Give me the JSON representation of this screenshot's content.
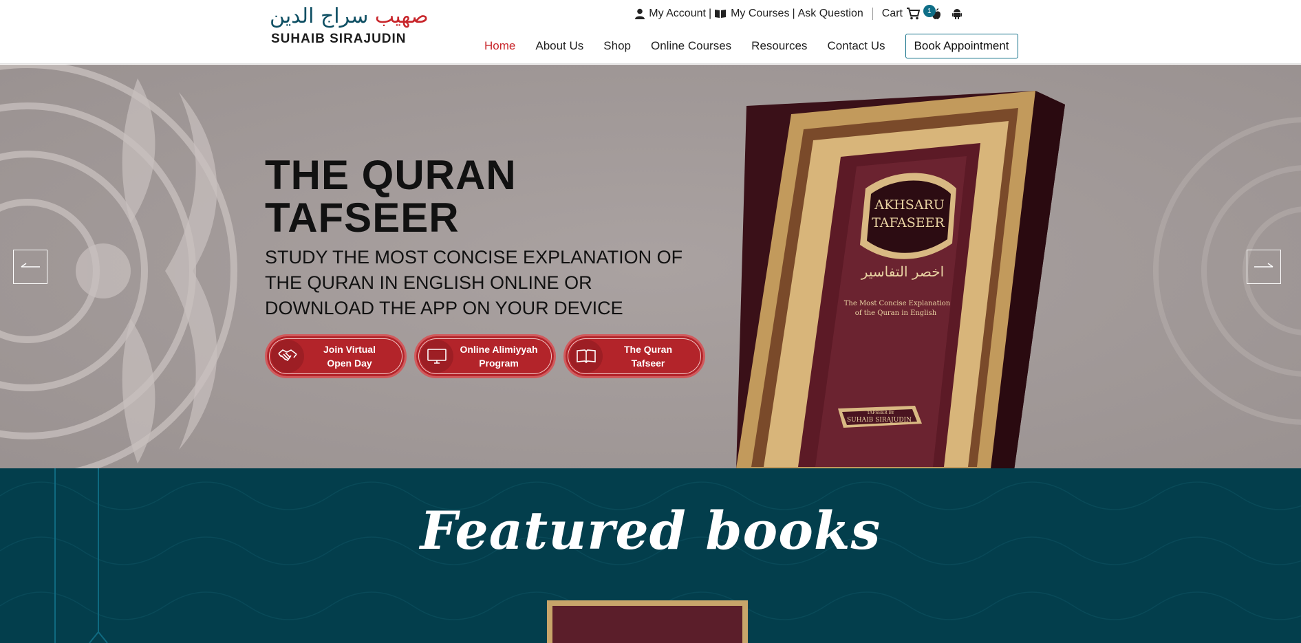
{
  "logo": {
    "arabic_part1": "صهيب",
    "arabic_part2": "سراج الدين",
    "english": "SUHAIB SIRAJUDIN"
  },
  "topbar": {
    "my_account": "My Account",
    "my_courses": "My Courses",
    "ask_question": "Ask Question",
    "cart": "Cart",
    "cart_count": "1",
    "icons": [
      "user-icon",
      "book-open-icon",
      "cart-icon",
      "apple-icon",
      "android-icon"
    ]
  },
  "nav": {
    "items": [
      {
        "label": "Home",
        "active": true
      },
      {
        "label": "About Us"
      },
      {
        "label": "Shop"
      },
      {
        "label": "Online Courses"
      },
      {
        "label": "Resources"
      },
      {
        "label": "Contact Us"
      }
    ],
    "book_appointment": "Book Appointment"
  },
  "hero": {
    "title_line1": "THE QURAN",
    "title_line2": "TAFSEER",
    "subtitle": "STUDY THE MOST CONCISE EXPLANATION OF THE QURAN IN ENGLISH ONLINE OR DOWNLOAD THE APP ON YOUR DEVICE",
    "buttons": [
      {
        "line1": "Join Virtual",
        "line2": "Open Day",
        "icon": "handshake-icon"
      },
      {
        "line1": "Online Alimiyyah",
        "line2": "Program",
        "icon": "monitor-icon"
      },
      {
        "line1": "The Quran",
        "line2": "Tafseer",
        "icon": "open-book-icon"
      }
    ],
    "book": {
      "title_line1": "AKHSARU",
      "title_line2": "TAFASEER",
      "arabic": "اخصر التفاسير",
      "tagline_line1": "The Most Concise Explanation",
      "tagline_line2": "of the Quran in English",
      "author_small": "TAFSEER BY",
      "author": "SUHAIB SIRAJUDIN"
    }
  },
  "featured": {
    "title": "Featured books"
  },
  "colors": {
    "brand_red": "#c8262b",
    "brand_teal": "#0e6e87",
    "featured_bg": "#033e4c",
    "hero_bg": "#a59d9c",
    "cta_red": "#b3242a"
  }
}
